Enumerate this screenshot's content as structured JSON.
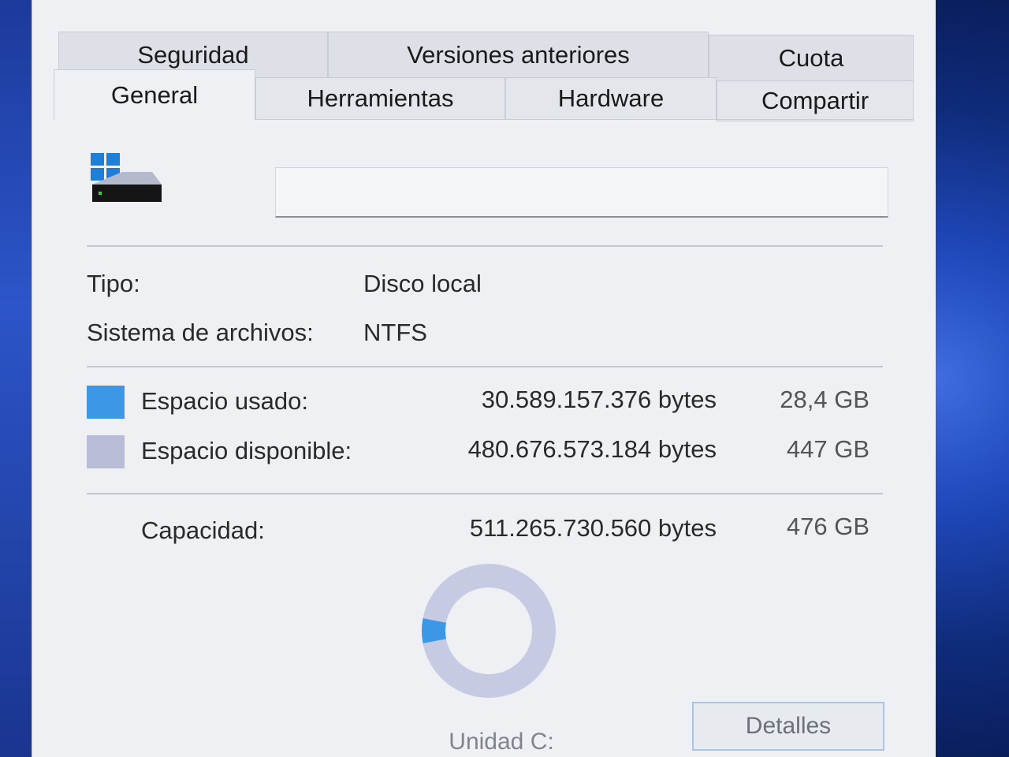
{
  "tabs_back": [
    "Seguridad",
    "Versiones anteriores",
    "Cuota"
  ],
  "tabs_front": [
    "General",
    "Herramientas",
    "Hardware",
    "Compartir"
  ],
  "active_tab": "General",
  "volume_name_value": "",
  "info": {
    "tipo_label": "Tipo:",
    "tipo_value": "Disco local",
    "fs_label": "Sistema de archivos:",
    "fs_value": "NTFS"
  },
  "space": {
    "used_label": "Espacio usado:",
    "used_bytes": "30.589.157.376 bytes",
    "used_size": "28,4 GB",
    "free_label": "Espacio disponible:",
    "free_bytes": "480.676.573.184 bytes",
    "free_size": "447 GB",
    "capacity_label": "Capacidad:",
    "capacity_bytes": "511.265.730.560 bytes",
    "capacity_size": "476 GB"
  },
  "usage_fraction": 0.06,
  "colors": {
    "used": "#3c97e6",
    "free": "#b9bcd6"
  },
  "drive_label": "Unidad C:",
  "details_button": "Detalles"
}
